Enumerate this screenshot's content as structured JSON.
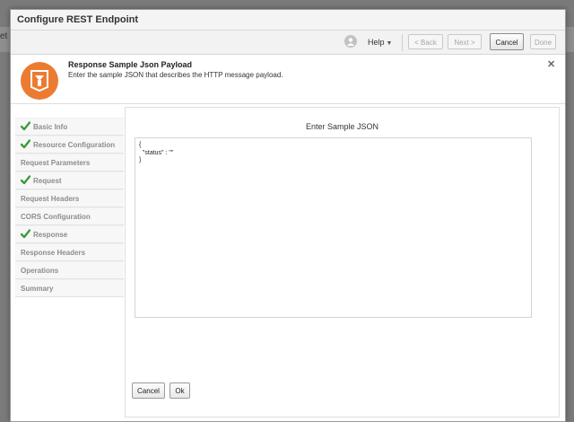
{
  "backdrop": {
    "partial_text": "et"
  },
  "dialog": {
    "title": "Configure REST Endpoint"
  },
  "toolbar": {
    "help_label": "Help",
    "help_caret": "▼",
    "back_label": "< Back",
    "next_label": "Next >",
    "cancel_label": "Cancel",
    "done_label": "Done"
  },
  "header": {
    "title": "Response Sample Json Payload",
    "description": "Enter the sample JSON that describes the HTTP message payload.",
    "close_glyph": "✕"
  },
  "train": {
    "steps": [
      {
        "label": "Basic Info",
        "completed": true
      },
      {
        "label": "Resource Configuration",
        "completed": true
      },
      {
        "label": "Request Parameters",
        "completed": false
      },
      {
        "label": "Request",
        "completed": true
      },
      {
        "label": "Request Headers",
        "completed": false
      },
      {
        "label": "CORS Configuration",
        "completed": false
      },
      {
        "label": "Response",
        "completed": true
      },
      {
        "label": "Response Headers",
        "completed": false
      },
      {
        "label": "Operations",
        "completed": false
      },
      {
        "label": "Summary",
        "completed": false
      }
    ]
  },
  "content": {
    "title": "Enter Sample JSON",
    "json_lines": [
      "{",
      "  \"status\" : \"\"",
      "}"
    ],
    "cancel_label": "Cancel",
    "ok_label": "Ok"
  },
  "colors": {
    "accent_orange": "#ec7b32",
    "check_green": "#3a9a3a"
  }
}
